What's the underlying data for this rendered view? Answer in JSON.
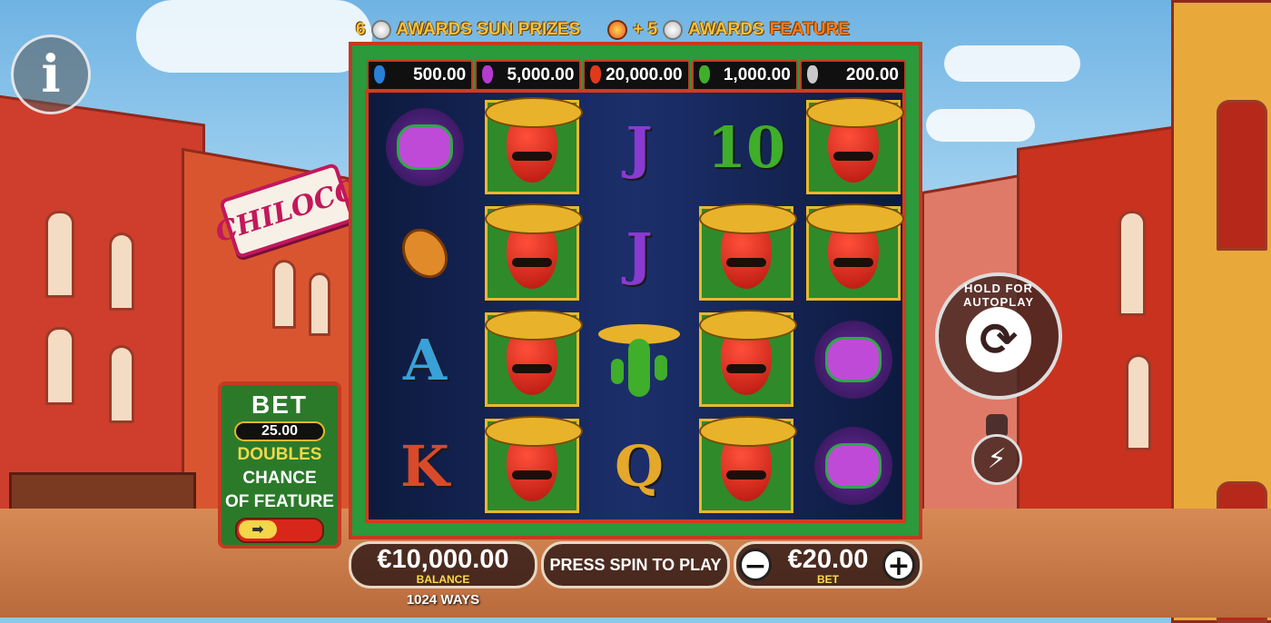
{
  "banner": {
    "left_count": "6",
    "left_text": "AWARDS SUN PRIZES",
    "right_plus": "+ 5",
    "right_text": "AWARDS",
    "right_highlight": "FEATURE"
  },
  "logo": "CHILOCO",
  "prizes": [
    {
      "value": "500.00",
      "color": "#2a7fd8"
    },
    {
      "value": "5,000.00",
      "color": "#b53ad0"
    },
    {
      "value": "20,000.00",
      "color": "#e0391c"
    },
    {
      "value": "1,000.00",
      "color": "#3fae2a"
    },
    {
      "value": "200.00",
      "color": "#c9c9c9"
    }
  ],
  "reels": [
    [
      "pinata-icon",
      "guitar-icon",
      "A",
      "K"
    ],
    [
      "pepper-icon",
      "pepper-icon",
      "pepper-icon",
      "pepper-icon"
    ],
    [
      "J",
      "J",
      "cactus-icon",
      "Q"
    ],
    [
      "10",
      "pepper-icon",
      "pepper-icon",
      "pepper-icon"
    ],
    [
      "pepper-icon",
      "pepper-icon",
      "pinata-icon",
      "pinata-icon"
    ]
  ],
  "bet_panel": {
    "title": "BET",
    "value": "25.00",
    "line1": "DOUBLES",
    "line2": "CHANCE",
    "line3": "OF FEATURE"
  },
  "balance": {
    "amount": "€10,000.00",
    "label": "BALANCE"
  },
  "ways": "1024 WAYS",
  "message": "PRESS SPIN TO PLAY",
  "bet": {
    "amount": "€20.00",
    "label": "BET",
    "minus": "−",
    "plus": "+"
  },
  "spin": {
    "hold_label": "HOLD FOR AUTOPLAY"
  },
  "info_label": "i"
}
